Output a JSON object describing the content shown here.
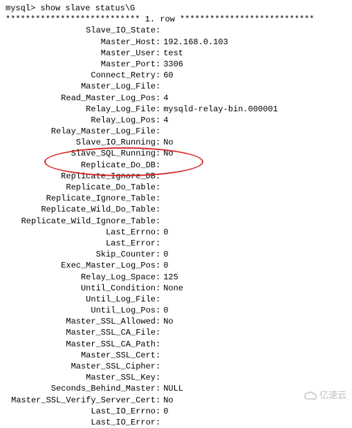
{
  "prompt": "mysql> show slave status\\G",
  "row_header": "*************************** 1. row ***************************",
  "rows": [
    {
      "label": "Slave_IO_State",
      "value": ""
    },
    {
      "label": "Master_Host",
      "value": "192.168.0.103"
    },
    {
      "label": "Master_User",
      "value": "test"
    },
    {
      "label": "Master_Port",
      "value": "3306"
    },
    {
      "label": "Connect_Retry",
      "value": "60"
    },
    {
      "label": "Master_Log_File",
      "value": ""
    },
    {
      "label": "Read_Master_Log_Pos",
      "value": "4"
    },
    {
      "label": "Relay_Log_File",
      "value": "mysqld-relay-bin.000001"
    },
    {
      "label": "Relay_Log_Pos",
      "value": "4"
    },
    {
      "label": "Relay_Master_Log_File",
      "value": ""
    },
    {
      "label": "Slave_IO_Running",
      "value": "No"
    },
    {
      "label": "Slave_SQL_Running",
      "value": "No"
    },
    {
      "label": "Replicate_Do_DB",
      "value": ""
    },
    {
      "label": "Replicate_Ignore_DB",
      "value": ""
    },
    {
      "label": "Replicate_Do_Table",
      "value": ""
    },
    {
      "label": "Replicate_Ignore_Table",
      "value": ""
    },
    {
      "label": "Replicate_Wild_Do_Table",
      "value": ""
    },
    {
      "label": "Replicate_Wild_Ignore_Table",
      "value": ""
    },
    {
      "label": "Last_Errno",
      "value": "0"
    },
    {
      "label": "Last_Error",
      "value": ""
    },
    {
      "label": "Skip_Counter",
      "value": "0"
    },
    {
      "label": "Exec_Master_Log_Pos",
      "value": "0"
    },
    {
      "label": "Relay_Log_Space",
      "value": "125"
    },
    {
      "label": "Until_Condition",
      "value": "None"
    },
    {
      "label": "Until_Log_File",
      "value": ""
    },
    {
      "label": "Until_Log_Pos",
      "value": "0"
    },
    {
      "label": "Master_SSL_Allowed",
      "value": "No"
    },
    {
      "label": "Master_SSL_CA_File",
      "value": ""
    },
    {
      "label": "Master_SSL_CA_Path",
      "value": ""
    },
    {
      "label": "Master_SSL_Cert",
      "value": ""
    },
    {
      "label": "Master_SSL_Cipher",
      "value": ""
    },
    {
      "label": "Master_SSL_Key",
      "value": ""
    },
    {
      "label": "Seconds_Behind_Master",
      "value": "NULL"
    },
    {
      "label": "Master_SSL_Verify_Server_Cert",
      "value": "No"
    },
    {
      "label": "Last_IO_Errno",
      "value": "0"
    },
    {
      "label": "Last_IO_Error",
      "value": ""
    }
  ],
  "watermark": {
    "text": "亿速云",
    "icon_color": "#bdbdbd"
  }
}
